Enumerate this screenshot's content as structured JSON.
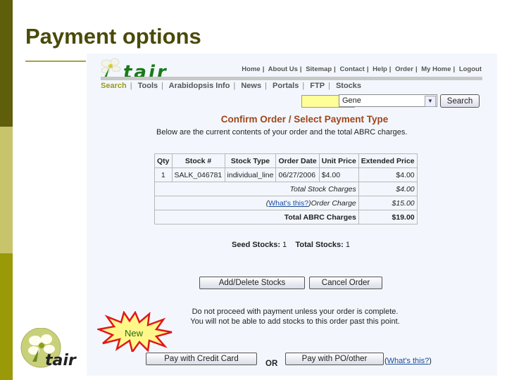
{
  "slide": {
    "title": "Payment options",
    "colors": {
      "band_dark": "#5f5e0a",
      "band_light": "#c8c46c",
      "band_mid": "#9a9a08",
      "title": "#4a4a0a"
    },
    "new_badge": "New",
    "corner_logo_text": "tair"
  },
  "site": {
    "logo_text": "tair",
    "top_nav": [
      "Home",
      "About Us",
      "Sitemap",
      "Contact",
      "Help",
      "Order",
      "My Home",
      "Logout"
    ],
    "main_nav": [
      {
        "label": "Search",
        "active": true
      },
      {
        "label": "Tools",
        "active": false
      },
      {
        "label": "Arabidopsis Info",
        "active": false
      },
      {
        "label": "News",
        "active": false
      },
      {
        "label": "Portals",
        "active": false
      },
      {
        "label": "FTP",
        "active": false
      },
      {
        "label": "Stocks",
        "active": false
      }
    ],
    "search": {
      "input_value": "",
      "select_value": "Gene",
      "button_label": "Search"
    }
  },
  "page": {
    "heading": "Confirm Order / Select Payment Type",
    "intro": "Below are the current contents of your order and the total ABRC charges.",
    "order_table": {
      "headers": [
        "Qty",
        "Stock #",
        "Stock Type",
        "Order Date",
        "Unit Price",
        "Extended Price"
      ],
      "rows": [
        [
          "1",
          "SALK_046781",
          "individual_line",
          "06/27/2006",
          "$4.00",
          "$4.00"
        ]
      ],
      "total_stock_charges_label": "Total Stock Charges",
      "total_stock_charges": "$4.00",
      "whats_this_link": "What's this?",
      "order_charge_label": "Order Charge",
      "order_charge": "$15.00",
      "total_abrc_label": "Total ABRC Charges",
      "total_abrc": "$19.00"
    },
    "summary": {
      "seed_label": "Seed Stocks:",
      "seed_value": "1",
      "total_label": "Total Stocks:",
      "total_value": "1"
    },
    "buttons": {
      "add_delete": "Add/Delete Stocks",
      "cancel": "Cancel Order",
      "credit_card": "Pay with Credit Card",
      "po_other": "Pay with PO/other"
    },
    "warning_line1": "Do not proceed with payment unless your order is complete.",
    "warning_line2": "You will not be able to add stocks to this order past this point.",
    "or_label": "OR",
    "whats_this_bottom": "What's this?"
  }
}
